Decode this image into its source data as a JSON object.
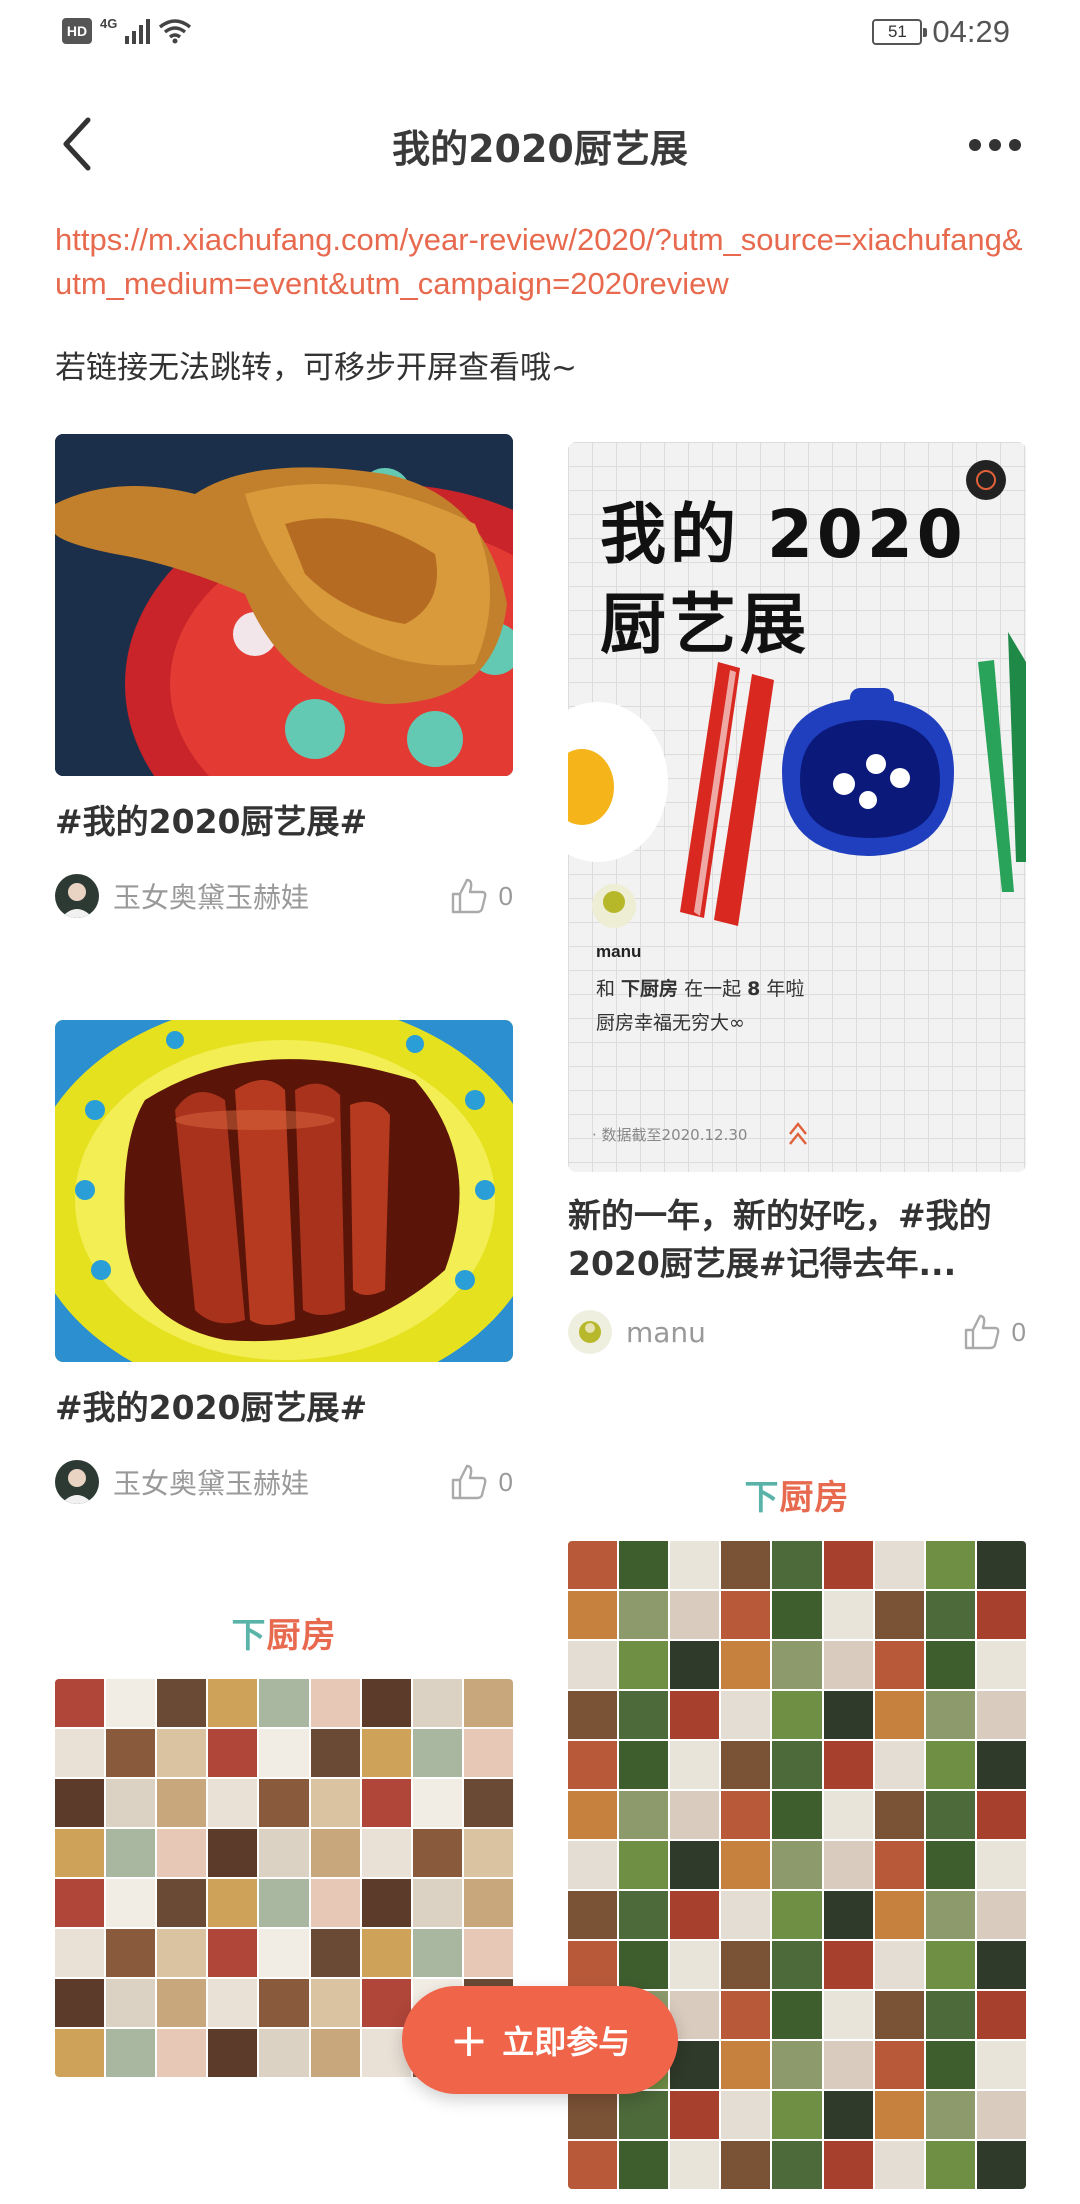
{
  "status": {
    "network": "4G",
    "hd": "HD",
    "battery": "51",
    "time": "04:29"
  },
  "header": {
    "title": "我的2020厨艺展"
  },
  "intro": {
    "link": "https://m.xiachufang.com/year-review/2020/?utm_source=xiachufang&utm_medium=event&utm_campaign=2020review",
    "hint": "若链接无法跳转，可移步开屏查看哦~"
  },
  "posts": [
    {
      "title": "#我的2020厨艺展#",
      "author": "玉女奥黛玉赫娃",
      "likes": "0"
    },
    {
      "title": "新的一年，新的好吃，#我的2020厨艺展#记得去年...",
      "author": "manu",
      "likes": "0"
    },
    {
      "title": "#我的2020厨艺展#",
      "author": "玉女奥黛玉赫娃",
      "likes": "0"
    }
  ],
  "poster": {
    "title_line1": "我的 2020",
    "title_line2": "厨艺展",
    "user": "manu",
    "line1_a": "和 ",
    "line1_brand": "下厨房",
    "line1_b": " 在一起 ",
    "line1_num": "8",
    "line1_c": " 年啦",
    "line2": "厨房幸福无穷大∞",
    "date": "· 数据截至2020.12.30"
  },
  "brand": {
    "part1": "下",
    "part2": "厨房"
  },
  "join_button": {
    "label": "立即参与"
  },
  "colors": {
    "accent": "#f0644a",
    "link": "#e76a4f",
    "brand_teal": "#5ab3a9"
  }
}
